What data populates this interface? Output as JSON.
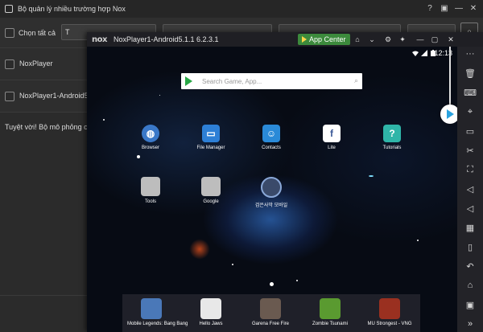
{
  "manager": {
    "title": "Bộ quản lý nhiều trường hợp Nox",
    "select_all": "Chọn tất cả",
    "toolbar_btn1": "T",
    "instances": [
      {
        "label": "NoxPlayer"
      },
      {
        "label": "NoxPlayer1-Android5."
      }
    ],
    "note": "Tuyệt vời! Bộ mô phỏng c"
  },
  "nox": {
    "logo": "nox",
    "title": "NoxPlayer1-Android5.1.1 6.2.3.1",
    "app_center": "App Center"
  },
  "android": {
    "time": "12:13",
    "search_placeholder": "Search Game, App...",
    "apps": [
      {
        "label": "Browser",
        "icon": "browser-icon",
        "color": "#3a78c8"
      },
      {
        "label": "File Manager",
        "icon": "folder-icon",
        "color": "#2d7fd6"
      },
      {
        "label": "Contacts",
        "icon": "contacts-icon",
        "color": "#2a8ad8"
      },
      {
        "label": "Lite",
        "icon": "facebook-icon",
        "color": "#ffffff"
      },
      {
        "label": "Tutorials",
        "icon": "tutorials-icon",
        "color": "#2fb5a8"
      },
      {
        "label": "Tools",
        "icon": "tools-folder-icon",
        "color": "#bdbdbd"
      },
      {
        "label": "Google",
        "icon": "google-folder-icon",
        "color": "#bdbdbd"
      },
      {
        "label": "검은사막 모바일",
        "icon": "game-icon",
        "color": "#3a4a6a"
      }
    ],
    "dock": [
      {
        "label": "Mobile Legends: Bang Bang",
        "color": "#4a78b8"
      },
      {
        "label": "Hello Jaws",
        "color": "#e8e8e8"
      },
      {
        "label": "Garena Free Fire",
        "color": "#6a5a50"
      },
      {
        "label": "Zombie Tsunami",
        "color": "#5a9a30"
      },
      {
        "label": "MU Strongest - VNG",
        "color": "#9a3020"
      }
    ]
  },
  "sidebar": {
    "icons": [
      "more-icon",
      "delete-icon",
      "keyboard-icon",
      "location-icon",
      "screen-icon",
      "scissors-icon",
      "fullscreen-icon",
      "volume-up-icon",
      "volume-down-icon",
      "apk-icon",
      "shake-icon",
      "back-icon",
      "home-icon",
      "recent-icon",
      "expand-icon"
    ]
  }
}
